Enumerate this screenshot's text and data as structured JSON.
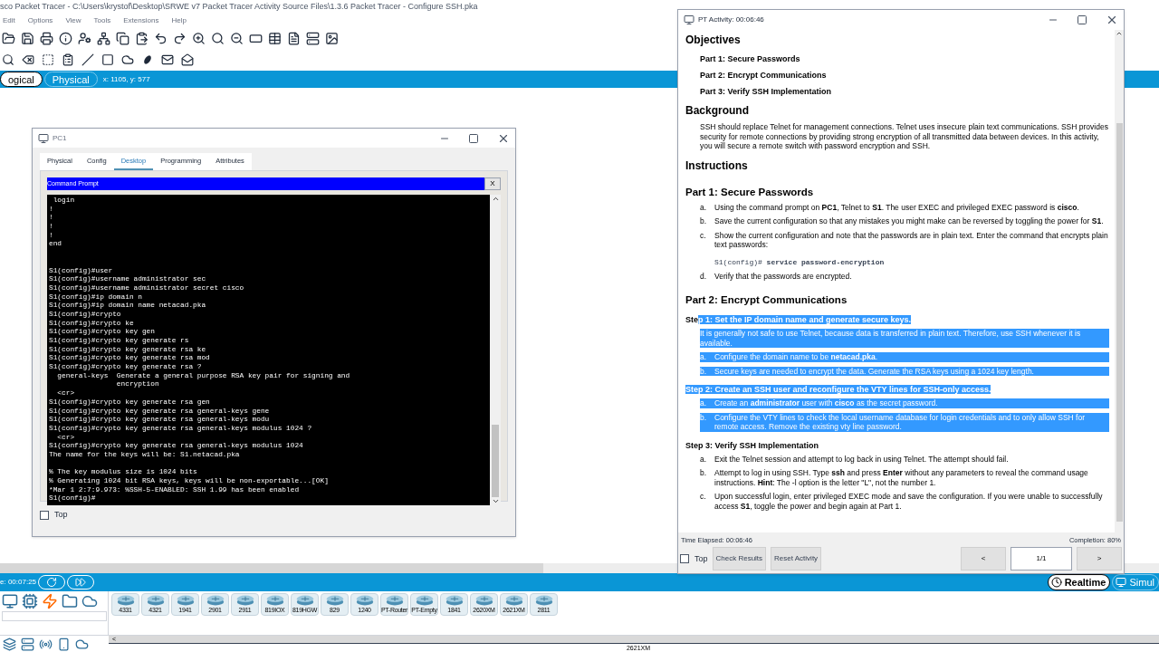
{
  "app": {
    "title": "sco Packet Tracer - C:\\Users\\krystof\\Desktop\\SRWE v7 Packet Tracer Activity Source Files\\1.3.6 Packet Tracer - Configure SSH.pka",
    "menu": [
      "Edit",
      "Options",
      "View",
      "Tools",
      "Extensions",
      "Help"
    ],
    "modes": [
      {
        "label": "ogical",
        "selected": true
      },
      {
        "label": "Physical",
        "selected": false
      }
    ],
    "coords": "x: 1105, y: 577",
    "clock": "e: 00:07:25",
    "sim_modes": [
      {
        "label": "Realtime",
        "selected": true
      },
      {
        "label": "Simul",
        "selected": false
      }
    ],
    "device_models": [
      "4331",
      "4321",
      "1941",
      "2901",
      "2911",
      "819IOX",
      "819HGW",
      "829",
      "1240",
      "PT-Router",
      "PT-Empty",
      "1841",
      "2620XM",
      "2621XM",
      "2811"
    ],
    "scroll_left": "<",
    "status": "2621XM"
  },
  "pc1": {
    "title": "PC1",
    "tabs": [
      {
        "label": "Physical",
        "selected": false
      },
      {
        "label": "Config",
        "selected": false
      },
      {
        "label": "Desktop",
        "selected": true
      },
      {
        "label": "Programming",
        "selected": false
      },
      {
        "label": "Attributes",
        "selected": false
      }
    ],
    "prompt_title": "Command Prompt",
    "prompt_close": "X",
    "line_groups": [
      {
        "kind": "top",
        "lines": [
          " login",
          "!",
          "!",
          "!",
          "!",
          "end"
        ]
      },
      {
        "kind": "wide",
        "lines": [
          "S1(config)#user",
          "S1(config)#username administrator sec",
          "S1(config)#username administrator secret cisco",
          "S1(config)#ip domain n",
          "S1(config)#ip domain name netacad.pka",
          "S1(config)#crypto",
          "S1(config)#crypto ke",
          "S1(config)#crypto key gen",
          "S1(config)#crypto key generate rs",
          "S1(config)#crypto key generate rsa ke",
          "S1(config)#crypto key generate rsa mod",
          "S1(config)#crypto key generate rsa ?",
          "  general-keys  Generate a general purpose RSA key pair for signing and",
          "                encryption",
          "  <cr>",
          "S1(config)#crypto key generate rsa gen",
          "S1(config)#crypto key generate rsa general-keys gene",
          "S1(config)#crypto key generate rsa general-keys modu",
          "S1(config)#crypto key generate rsa general-keys modulus 1024 ?",
          "  <cr>",
          "S1(config)#crypto key generate rsa general-keys modulus 1024",
          "The name for the keys will be: S1.netacad.pka"
        ]
      },
      {
        "kind": "spaced",
        "lines": [
          "% The key modulus size is 1024 bits",
          "% Generating 1024 bit RSA keys, keys will be non-exportable...[OK]",
          "*Mar 1 2:7:9.973: %SSH-5-ENABLED: SSH 1.99 has been enabled",
          "S1(config)#"
        ]
      }
    ],
    "top": {
      "label": "Top",
      "checked": false
    }
  },
  "activity": {
    "title": "PT Activity: 00:06:46",
    "blocks": [
      {
        "kind": "h1",
        "text": "Objectives",
        "highlighted": false
      },
      {
        "kind": "sub",
        "text": "Part 1: Secure Passwords",
        "highlighted": false
      },
      {
        "kind": "sub",
        "text": "Part 2: Encrypt Communications",
        "highlighted": false
      },
      {
        "kind": "sub",
        "text": "Part 3: Verify SSH Implementation",
        "highlighted": false
      },
      {
        "kind": "h1",
        "text": "Background",
        "highlighted": false
      },
      {
        "kind": "para",
        "text": "SSH should replace Telnet for management connections. Telnet uses insecure plain text communications. SSH provides security for remote connections by providing strong encryption of all transmitted data between devices. In this activity, you will secure a remote switch with password encryption and SSH.",
        "highlighted": false
      },
      {
        "kind": "h1",
        "text": "Instructions",
        "highlighted": false
      },
      {
        "kind": "h2",
        "text": "Part 1: Secure Passwords",
        "highlighted": false
      },
      {
        "kind": "item",
        "letter": "a.",
        "text": "Using the command prompt on **PC1**, Telnet to **S1**. The user EXEC and privileged EXEC password is **cisco**.",
        "highlighted": false
      },
      {
        "kind": "item",
        "letter": "b.",
        "text": "Save the current configuration so that any mistakes you might make can be reversed by toggling the power for **S1**.",
        "highlighted": false
      },
      {
        "kind": "item",
        "letter": "c.",
        "text": "Show the current configuration and note that the passwords are in plain text. Enter the command that encrypts plain text passwords:",
        "highlighted": false
      },
      {
        "kind": "code",
        "text": "S1(config)# **service password-encryption**",
        "highlighted": false
      },
      {
        "kind": "item",
        "letter": "d.",
        "text": "Verify that the passwords are encrypted.",
        "highlighted": false
      },
      {
        "kind": "h2",
        "text": "Part 2: Encrypt Communications",
        "highlighted": false
      },
      {
        "kind": "h3",
        "segments": [
          {
            "text": "Ste",
            "highlighted": false
          },
          {
            "text": "p 1: Set the IP domain name and generate secure keys.",
            "highlighted": true
          }
        ]
      },
      {
        "kind": "para",
        "text": "It is generally not safe to use Telnet, because data is transferred in plain text. Therefore, use SSH whenever it is available.",
        "highlighted": true
      },
      {
        "kind": "item",
        "letter": "a.",
        "text": "Configure the domain name to be **netacad.pka**.",
        "highlighted": true
      },
      {
        "kind": "item",
        "letter": "b.",
        "text": "Secure keys are needed to encrypt the data. Generate the RSA keys using a 1024 key length.",
        "highlighted": true
      },
      {
        "kind": "h3",
        "segments": [
          {
            "text": "Step 2: Create an SSH user and reconfigure the VTY lines for SSH-only access.",
            "highlighted": true
          }
        ]
      },
      {
        "kind": "item",
        "letter": "a.",
        "text": "Create an **administrator** user with **cisco** as the secret password.",
        "highlighted": true
      },
      {
        "kind": "item",
        "letter": "b.",
        "text": "Configure the VTY lines to check the local username database for login credentials and to only allow SSH for remote access. Remove the existing vty line password.",
        "highlighted": true
      },
      {
        "kind": "h3",
        "segments": [
          {
            "text": "Step 3: Verify SSH Implementation",
            "highlighted": false
          }
        ]
      },
      {
        "kind": "item",
        "letter": "a.",
        "text": "Exit the Telnet session and attempt to log back in using Telnet. The attempt should fail.",
        "highlighted": false
      },
      {
        "kind": "item",
        "letter": "b.",
        "text": "Attempt to log in using SSH. Type **ssh** and press **Enter** without any parameters to reveal the command usage instructions. **Hint**: The -l option is the letter \"L\", not the number 1.",
        "highlighted": false
      },
      {
        "kind": "item",
        "letter": "c.",
        "text": "Upon successful login, enter privileged EXEC mode and save the configuration. If you were unable to successfully access **S1**, toggle the power and begin again at Part 1.",
        "highlighted": false
      }
    ],
    "time_elapsed": "Time Elapsed: 00:06:46",
    "completion": "Completion: 80%",
    "top": {
      "label": "Top",
      "checked": false
    },
    "buttons": [
      "Check Results",
      "Reset Activity"
    ],
    "prev": "<",
    "page": "1/1",
    "next": ">"
  }
}
